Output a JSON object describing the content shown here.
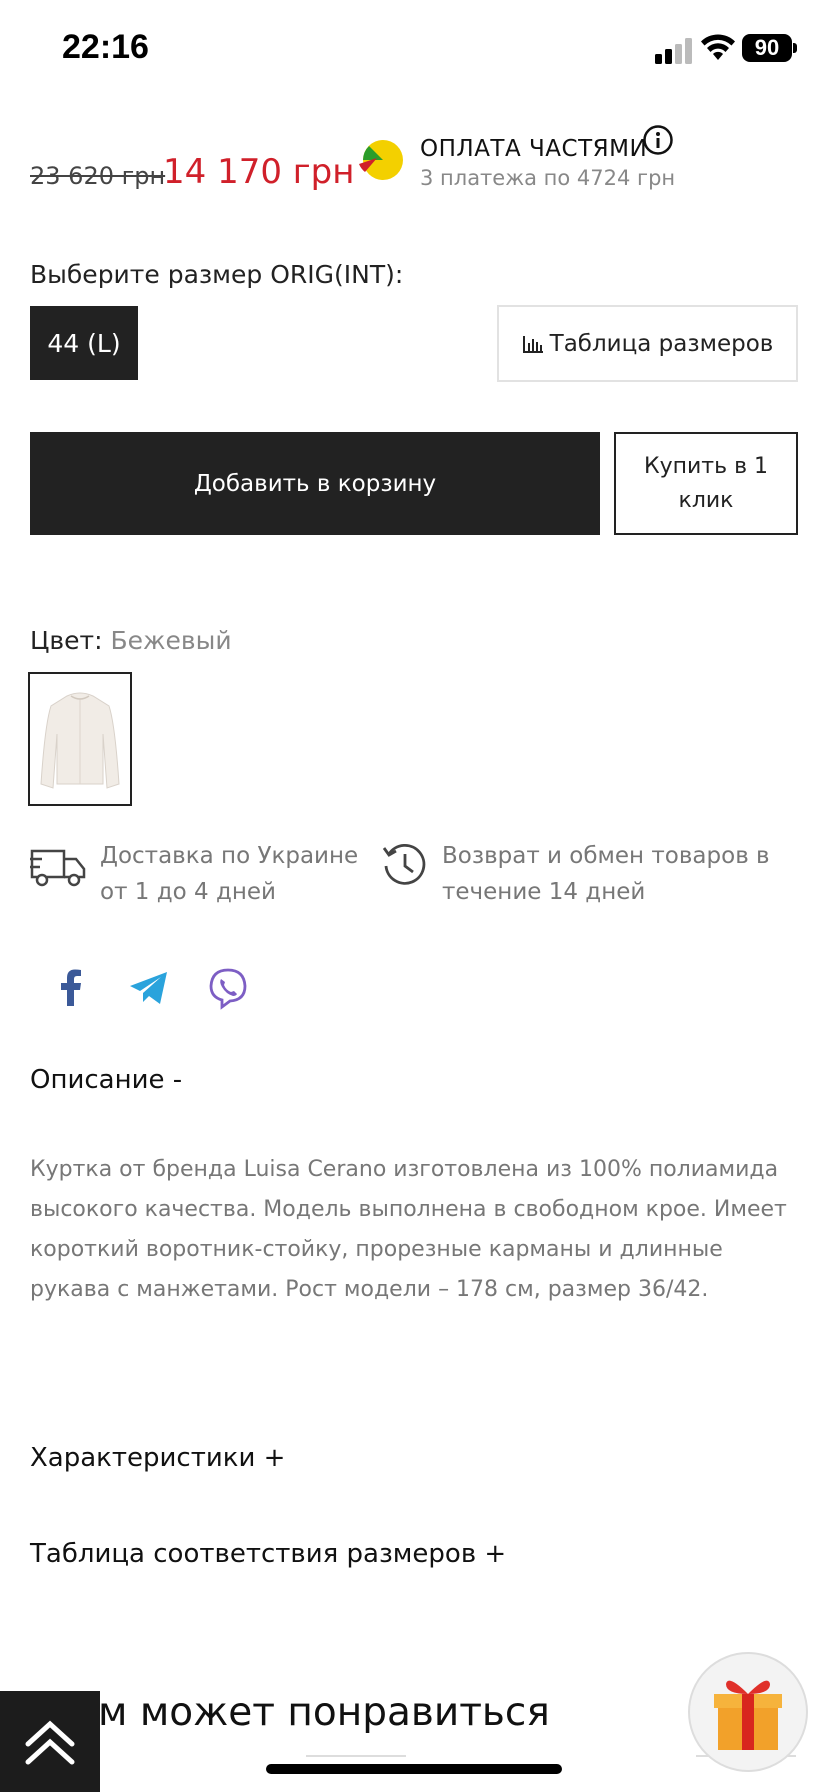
{
  "status": {
    "time": "22:16",
    "battery": "90"
  },
  "price": {
    "old": "23 620 грн",
    "new": "14 170 грн"
  },
  "installments": {
    "title": "ОПЛАТА ЧАСТЯМИ",
    "subtitle": "3 платежа по 4724 грн"
  },
  "size": {
    "label": "Выберите размер ORIG(INT):",
    "selected": "44 (L)",
    "table_button": "Таблица размеров"
  },
  "actions": {
    "add_to_cart": "Добавить в корзину",
    "buy_one_click": "Купить в 1 клик"
  },
  "color": {
    "label": "Цвет:",
    "value": "Бежевый"
  },
  "delivery": {
    "shipping": "Доставка по Украине от 1 до 4 дней",
    "returns": "Возврат и обмен товаров в течение 14 дней"
  },
  "social": [
    "facebook-icon",
    "telegram-icon",
    "viber-icon"
  ],
  "description": {
    "title": "Описание  -",
    "body": "Куртка от бренда Luisa Cerano изготовлена из 100% полиамида высокого качества. Модель выполнена в свободном крое. Имеет короткий воротник-стойку, прорезные карманы и длинные рукава с манжетами. Рост модели – 178 см, размер 36/42."
  },
  "sections": {
    "characteristics": "Характеристики  +",
    "size_chart": "Таблица соответствия размеров  +"
  },
  "recommendations": {
    "title": "м может понравиться"
  },
  "colors": {
    "sale_red": "#d0202a",
    "dark": "#222222",
    "muted": "#777777",
    "facebook": "#3b5998",
    "telegram": "#2aa3dc",
    "viber": "#7d5ec4"
  }
}
